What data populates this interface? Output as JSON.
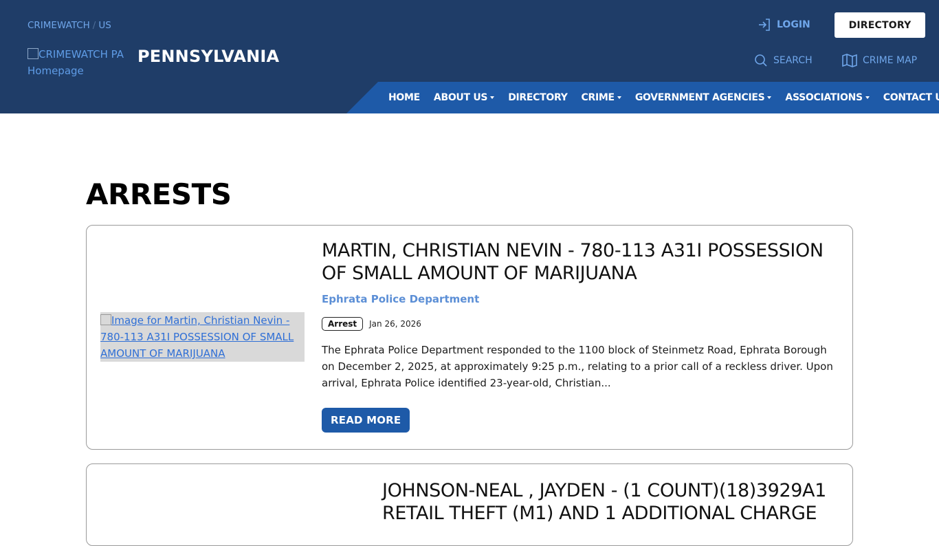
{
  "breadcrumb": {
    "root": "CRIMEWATCH",
    "separator": "/",
    "current": "US"
  },
  "logo": {
    "alt": "CRIMEWATCH PA Homepage"
  },
  "site_title": "PENNSYLVANIA",
  "top_links": {
    "login": "LOGIN",
    "directory": "DIRECTORY",
    "search": "SEARCH",
    "crime_map": "CRIME MAP"
  },
  "nav": [
    {
      "label": "HOME",
      "dropdown": false
    },
    {
      "label": "ABOUT US",
      "dropdown": true
    },
    {
      "label": "DIRECTORY",
      "dropdown": false
    },
    {
      "label": "CRIME",
      "dropdown": true
    },
    {
      "label": "GOVERNMENT AGENCIES",
      "dropdown": true
    },
    {
      "label": "ASSOCIATIONS",
      "dropdown": true
    },
    {
      "label": "CONTACT US",
      "dropdown": false
    }
  ],
  "page_title": "ARRESTS",
  "posts": [
    {
      "title": "MARTIN, CHRISTIAN NEVIN - 780-113 A31I POSSESSION OF SMALL AMOUNT OF MARIJUANA",
      "image_alt": "Image for Martin, Christian Nevin - 780-113 A31I POSSESSION OF SMALL AMOUNT OF MARIJUANA",
      "agency": "Ephrata Police Department",
      "tag": "Arrest",
      "date": "Jan 26, 2026",
      "excerpt": "The Ephrata Police Department responded to the 1100 block of Steinmetz Road, Ephrata Borough on December 2, 2025, at approximately 9:25 p.m., relating to a prior call of a reckless driver.  Upon arrival, Ephrata Police identified 23-year-old, Christian...",
      "read_more": "READ MORE"
    },
    {
      "title": "JOHNSON-NEAL , JAYDEN - (1 COUNT)(18)3929A1 RETAIL THEFT (M1) AND 1 ADDITIONAL CHARGE"
    }
  ],
  "colors": {
    "header_bg": "#1f3d68",
    "nav_bg": "#1e5aa8",
    "link": "#6fa6ea",
    "agency": "#5c8fd6"
  }
}
